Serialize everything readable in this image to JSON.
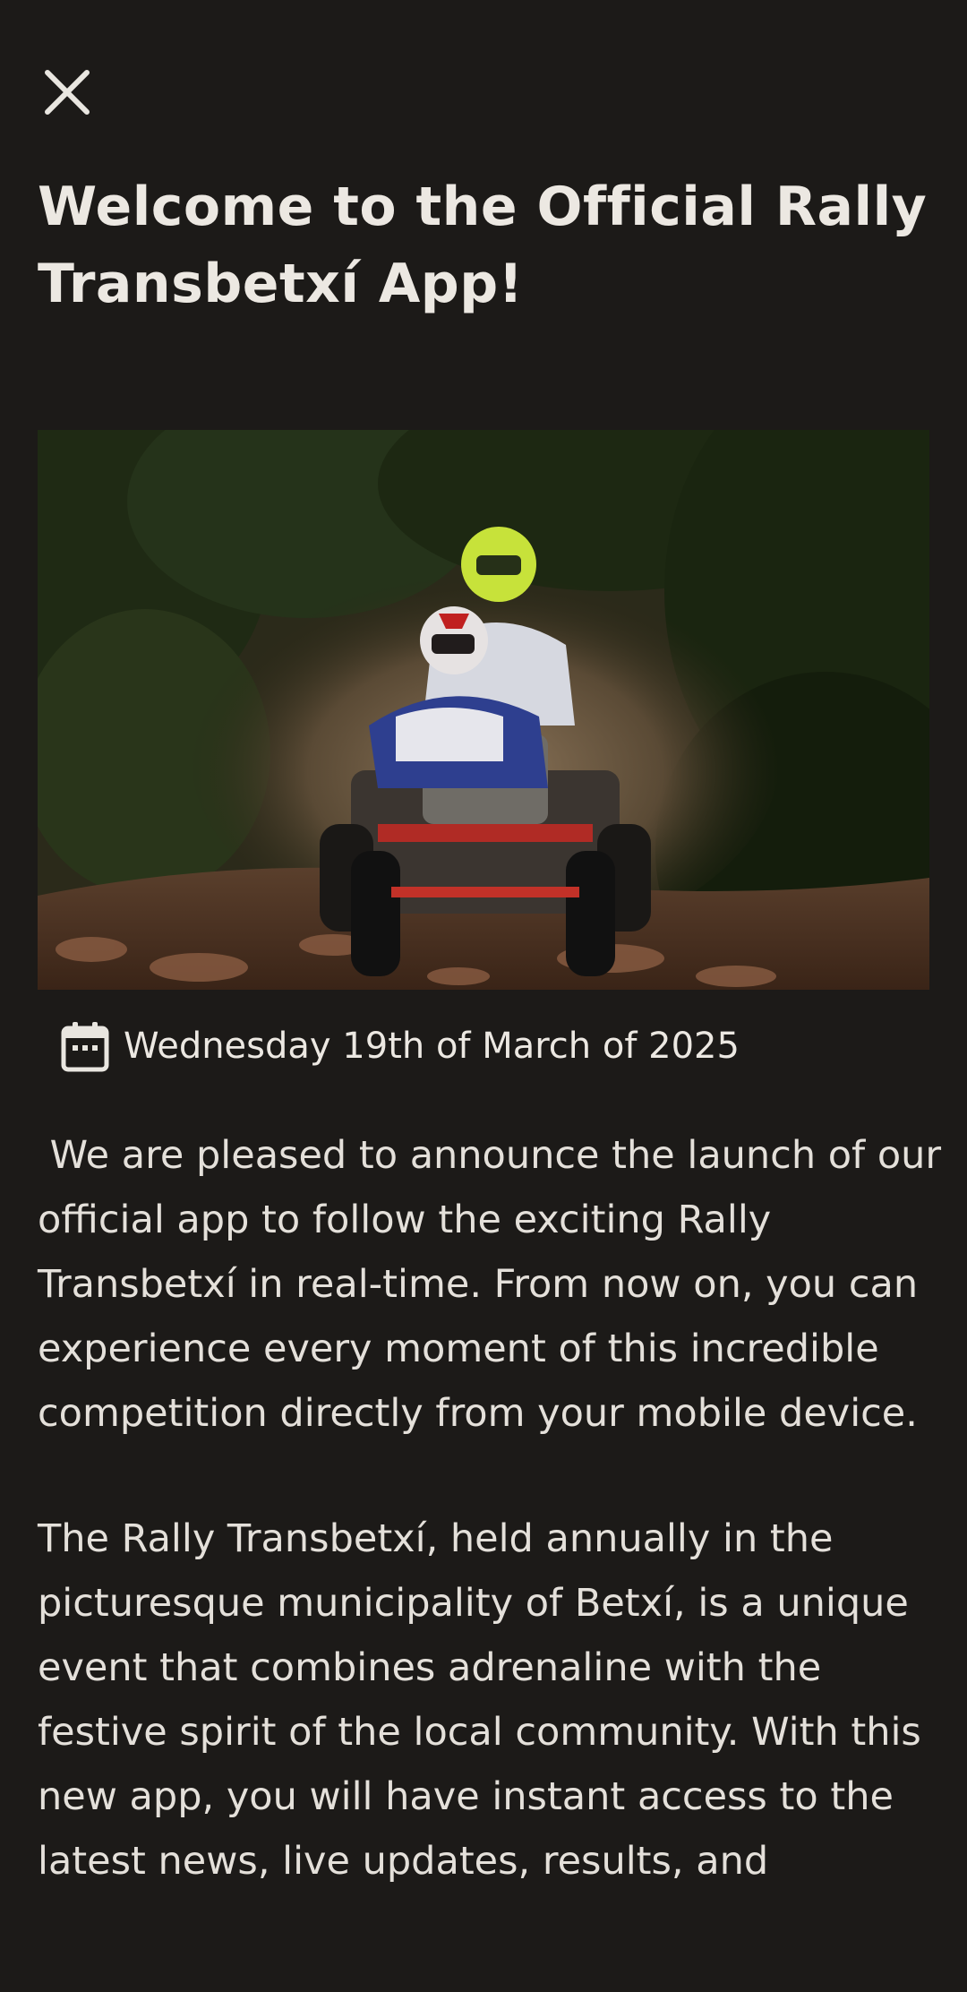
{
  "header": {
    "close_icon": "close-icon"
  },
  "article": {
    "title": "Welcome to the Official Rally Transbetxí App!",
    "image_alt": "Quad sidecar with two helmeted riders racing on a dusty rocky trail through trees",
    "date_icon": "calendar-icon",
    "date": "Wednesday 19th of March of 2025",
    "paragraph_1": " We are pleased to announce the launch of our official app to follow the exciting Rally Transbetxí in real-time. From now on, you can experience every moment of this incredible competition directly from your mobile device.",
    "paragraph_2": "The Rally Transbetxí, held annually in the picturesque municipality of Betxí, is a unique event that combines adrenaline with the festive spirit of the local community. With this new app, you will have instant access to the latest news, live updates, results, and"
  },
  "colors": {
    "background": "#1c1a18",
    "text": "#e9e6e0"
  }
}
